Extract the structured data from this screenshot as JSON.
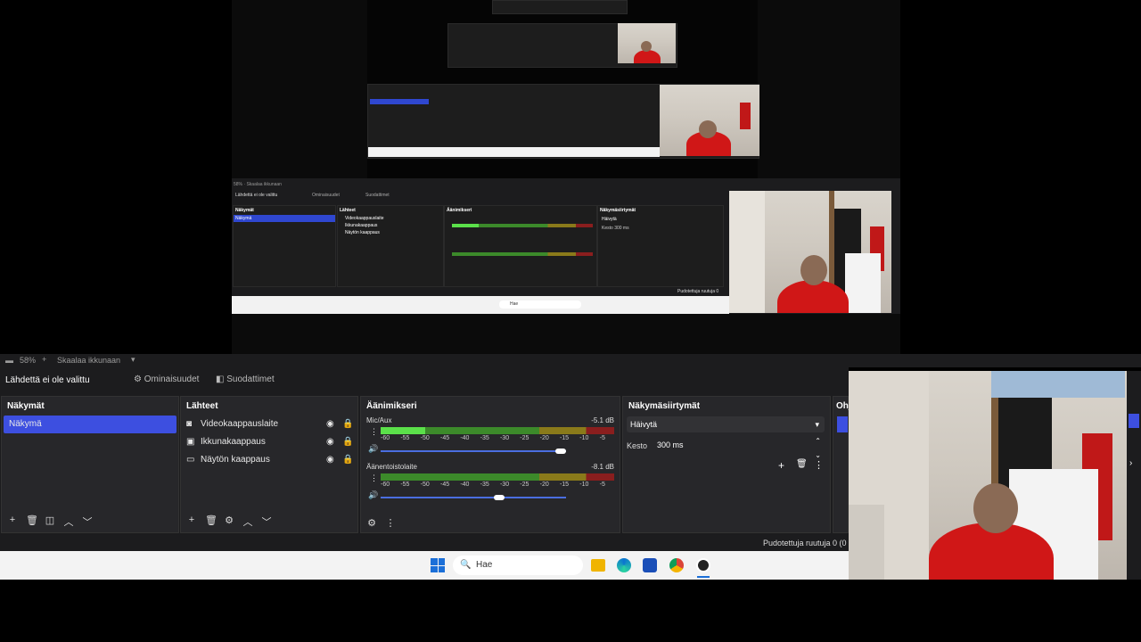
{
  "preview": {
    "nested_scale": "58%",
    "nested_scale_mode": "Skaalaa ikkunaan",
    "nested_no_source": "Lähdettä ei ole valittu",
    "nested_properties": "Ominaisuudet",
    "nested_filters": "Suodattimet",
    "nested_scenes_title": "Näkymät",
    "nested_scene": "Näkymä",
    "nested_sources_title": "Lähteet",
    "nested_sources": [
      "Videokaappauslaite",
      "Ikkunakaappaus",
      "Näytön kaappaus"
    ],
    "nested_mixer_title": "Äänimikseri",
    "nested_transitions_title": "Näkymäsiirtymät",
    "nested_transition": "Häivytä",
    "nested_duration_label": "Kesto",
    "nested_duration": "300 ms",
    "nested_dropped": "Pudotettuja ruutuja 0",
    "nested_search": "Hae"
  },
  "scale_row": {
    "zoom": "58%",
    "mode": "Skaalaa ikkunaan"
  },
  "toolbar": {
    "no_source": "Lähdettä ei ole valittu",
    "properties_label": "Ominaisuudet",
    "filters_label": "Suodattimet"
  },
  "scenes": {
    "title": "Näkymät",
    "items": [
      "Näkymä"
    ]
  },
  "sources": {
    "title": "Lähteet",
    "items": [
      {
        "label": "Videokaappauslaite",
        "icon": "camera-icon"
      },
      {
        "label": "Ikkunakaappaus",
        "icon": "window-icon"
      },
      {
        "label": "Näytön kaappaus",
        "icon": "monitor-icon"
      }
    ]
  },
  "mixer": {
    "title": "Äänimikseri",
    "channels": [
      {
        "name": "Mic/Aux",
        "db": "-5.1 dB",
        "level": 0.19,
        "volume": 1.0
      },
      {
        "name": "Äänentoistolaite",
        "db": "-8.1 dB",
        "level": 0.0,
        "volume": 0.67
      }
    ],
    "ticks": [
      "-60",
      "-55",
      "-50",
      "-45",
      "-40",
      "-35",
      "-30",
      "-25",
      "-20",
      "-15",
      "-10",
      "-5"
    ]
  },
  "transitions": {
    "title": "Näkymäsiirtymät",
    "selected": "Häivytä",
    "duration_label": "Kesto",
    "duration_value": "300 ms"
  },
  "controls": {
    "title": "Ohj"
  },
  "status": {
    "dropped": "Pudotettuja ruutuja 0 (0"
  },
  "taskbar": {
    "search_placeholder": "Hae"
  },
  "colors": {
    "accent": "#3d4fe0",
    "dock_bg": "#27272a",
    "window_bg": "#1c1c1e"
  }
}
